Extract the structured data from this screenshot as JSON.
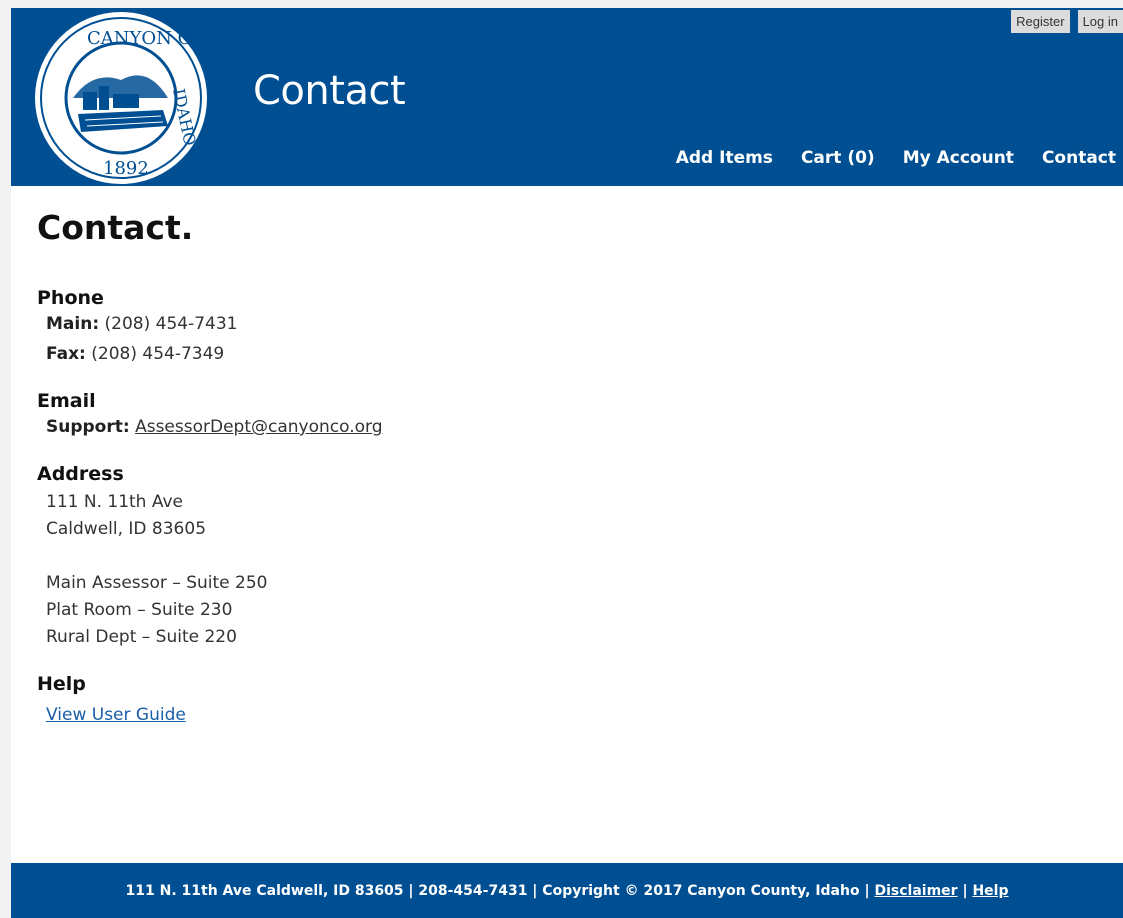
{
  "header": {
    "logo": {
      "icon": "county-seal-icon",
      "text_top": "CANYON COUNTY",
      "text_right": "IDAHO",
      "year": "1892"
    },
    "site_title": "Contact",
    "auth": {
      "register": "Register",
      "login": "Log in"
    },
    "nav": [
      "Add Items",
      "Cart (0)",
      "My Account",
      "Contact"
    ]
  },
  "main": {
    "heading": "Contact.",
    "phone": {
      "heading": "Phone",
      "main_label": "Main:",
      "main_value": "(208) 454-7431",
      "fax_label": "Fax:",
      "fax_value": "(208) 454-7349"
    },
    "email": {
      "heading": "Email",
      "support_label": "Support:",
      "support_value": "AssessorDept@canyonco.org"
    },
    "address": {
      "heading": "Address",
      "lines": [
        "111 N. 11th Ave",
        "Caldwell, ID 83605"
      ],
      "suites": [
        "Main Assessor – Suite 250",
        "Plat Room – Suite 230",
        "Rural Dept – Suite 220"
      ]
    },
    "help": {
      "heading": "Help",
      "link": "View User Guide"
    }
  },
  "footer": {
    "text": "111 N. 11th Ave Caldwell, ID 83605 | 208-454-7431 | Copyright © 2017 Canyon County, Idaho |",
    "disclaimer": "Disclaimer",
    "separator": "|",
    "help": "Help"
  },
  "colors": {
    "brand_blue": "#004f93",
    "link_blue": "#1a5ea8"
  }
}
